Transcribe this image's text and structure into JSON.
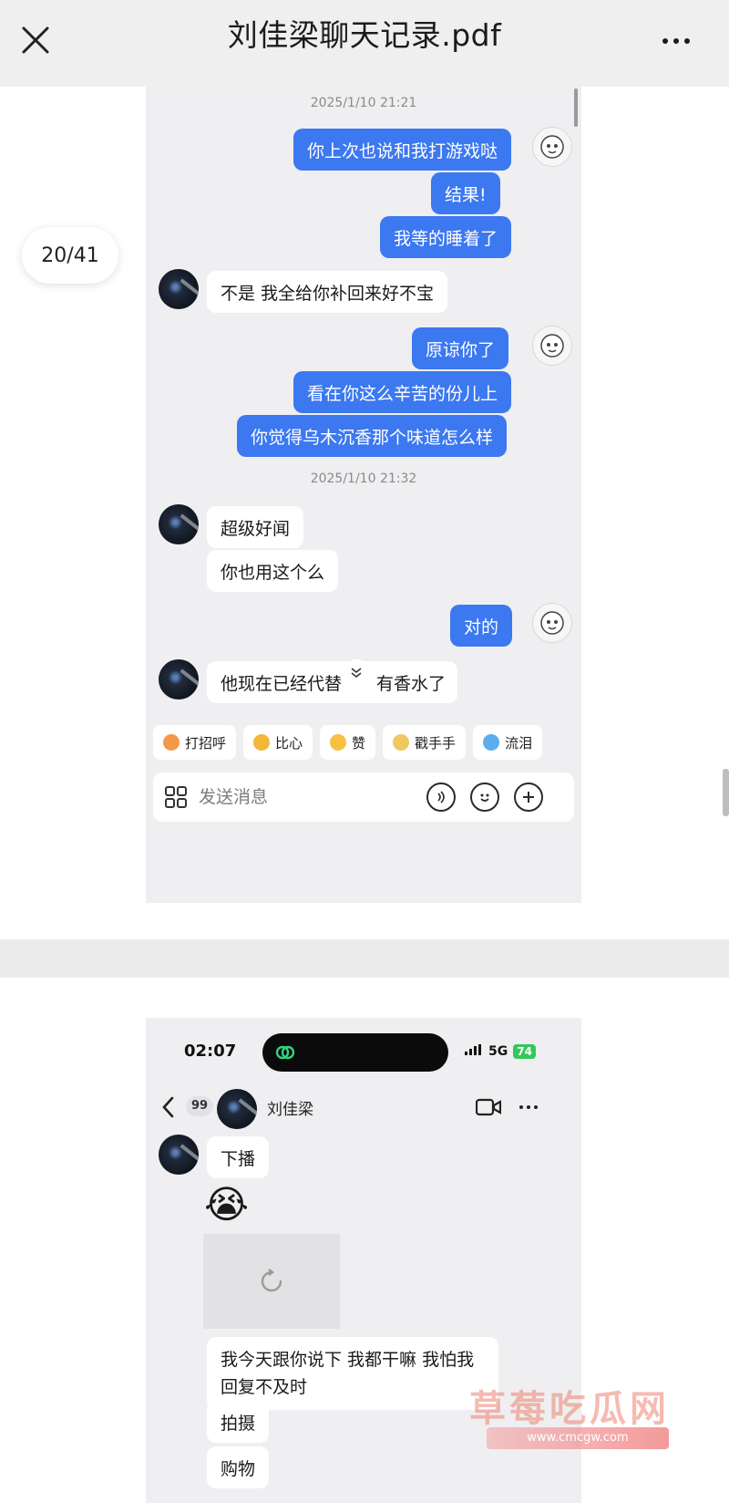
{
  "viewer": {
    "title": "刘佳梁聊天记录.pdf",
    "page_indicator": "20/41"
  },
  "page1": {
    "timestamps": [
      "2025/1/10 21:21",
      "2025/1/10 21:32"
    ],
    "messages": [
      {
        "dir": "out",
        "text": "你上次也说和我打游戏哒"
      },
      {
        "dir": "out",
        "text": "结果!"
      },
      {
        "dir": "out",
        "text": "我等的睡着了"
      },
      {
        "dir": "in",
        "text": "不是 我全给你补回来好不宝"
      },
      {
        "dir": "out",
        "text": "原谅你了"
      },
      {
        "dir": "out",
        "text": "看在你这么辛苦的份儿上"
      },
      {
        "dir": "out",
        "text": "你觉得乌木沉香那个味道怎么样"
      },
      {
        "dir": "in",
        "text": "超级好闻"
      },
      {
        "dir": "in",
        "text": "你也用这个么"
      },
      {
        "dir": "out",
        "text": "对的"
      },
      {
        "dir": "in",
        "text": "他现在已经代替"
      },
      {
        "dir": "in",
        "text": "有香水了"
      }
    ],
    "quick_replies": [
      {
        "label": "打招呼",
        "color": "#f29a4a"
      },
      {
        "label": "比心",
        "color": "#f4b638"
      },
      {
        "label": "赞",
        "color": "#f6c042"
      },
      {
        "label": "戳手手",
        "color": "#f0c860"
      },
      {
        "label": "流泪",
        "color": "#5aaef0"
      }
    ],
    "input_placeholder": "发送消息"
  },
  "page2": {
    "status": {
      "time": "02:07",
      "network": "5G",
      "battery": "74"
    },
    "nav": {
      "unread": "99",
      "contact": "刘佳梁"
    },
    "messages": [
      {
        "dir": "in",
        "text": "下播"
      },
      {
        "dir": "in",
        "text": "😭"
      },
      {
        "dir": "in",
        "text": "我今天跟你说下 我都干嘛 我怕我回复不及时"
      },
      {
        "dir": "in",
        "text": "拍摄"
      },
      {
        "dir": "in",
        "text": "购物"
      }
    ]
  },
  "watermark": {
    "text": "草莓吃瓜网",
    "url": "www.cmcgw.com"
  },
  "colors": {
    "outgoing_bubble": "#3c78f0",
    "incoming_bubble": "#ffffff",
    "chat_background": "#efeff1"
  }
}
